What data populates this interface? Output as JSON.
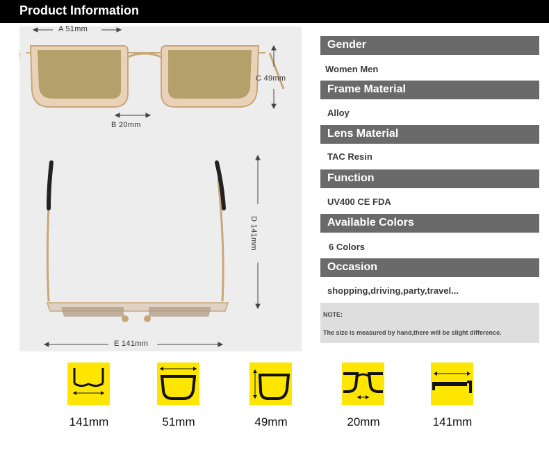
{
  "header": {
    "title": "Product Information"
  },
  "dimensions": {
    "a": "A 51mm",
    "b": "B 20mm",
    "c": "C 49mm",
    "d": "D 141mm",
    "e": "E 141mm"
  },
  "specs": [
    {
      "heading": "Gender",
      "value": "Women Men"
    },
    {
      "heading": "Frame Material",
      "value": "Alloy"
    },
    {
      "heading": "Lens Material",
      "value": "TAC Resin"
    },
    {
      "heading": "Function",
      "value": "UV400 CE FDA"
    },
    {
      "heading": "Available Colors",
      "value": "6 Colors"
    },
    {
      "heading": "Occasion",
      "value": "shopping,driving,party,travel..."
    }
  ],
  "note": {
    "title": "NOTE:",
    "text": "The size is measured by hand,there will be slight difference."
  },
  "measure_icons": [
    {
      "icon": "temple-length-icon",
      "label": "141mm"
    },
    {
      "icon": "lens-width-icon",
      "label": "51mm"
    },
    {
      "icon": "lens-height-icon",
      "label": "49mm"
    },
    {
      "icon": "bridge-width-icon",
      "label": "20mm"
    },
    {
      "icon": "arm-length-icon",
      "label": "141mm"
    }
  ],
  "colors": {
    "header_bg": "#000000",
    "spec_heading_bg": "#6a6a6a",
    "icon_bg": "#ffe600",
    "photo_bg": "#ededed",
    "note_bg": "#dedede"
  }
}
